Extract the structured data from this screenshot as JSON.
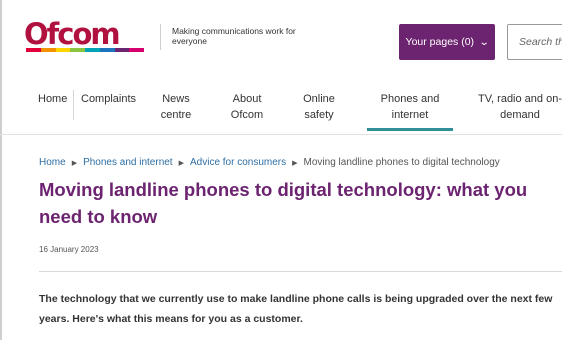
{
  "header": {
    "logo_text": "Ofcom",
    "tagline": "Making communications work for everyone",
    "your_pages_label": "Your pages (0)",
    "your_pages_icon": "chevron-down-icon",
    "search_placeholder": "Search this site",
    "brand_colors": {
      "logo": "#b0113f",
      "stripe": [
        "#e4003a",
        "#f39200",
        "#ffd500",
        "#8bc53f",
        "#00a4b4",
        "#1c75bc",
        "#6c2370",
        "#d6006e"
      ],
      "button": "#6c2370"
    }
  },
  "nav": {
    "items": [
      {
        "label": "Home"
      },
      {
        "label": "Complaints"
      },
      {
        "label": "News\ncentre"
      },
      {
        "label": "About\nOfcom"
      },
      {
        "label": "Online\nsafety"
      },
      {
        "label": "Phones and\ninternet",
        "active": true
      },
      {
        "label": "TV, radio and on-\ndemand"
      }
    ],
    "active_color": "#2e8f97"
  },
  "breadcrumb": {
    "items": [
      "Home",
      "Phones and internet",
      "Advice for consumers"
    ],
    "current": "Moving landline phones to digital technology",
    "link_color": "#2d6ea3"
  },
  "article": {
    "title": "Moving landline phones to digital technology: what you need to know",
    "title_color": "#6c2370",
    "date": "16 January 2023",
    "intro": "The technology that we currently use to make landline phone calls is being upgraded over the next few years. Here's what this means for you as a customer."
  }
}
